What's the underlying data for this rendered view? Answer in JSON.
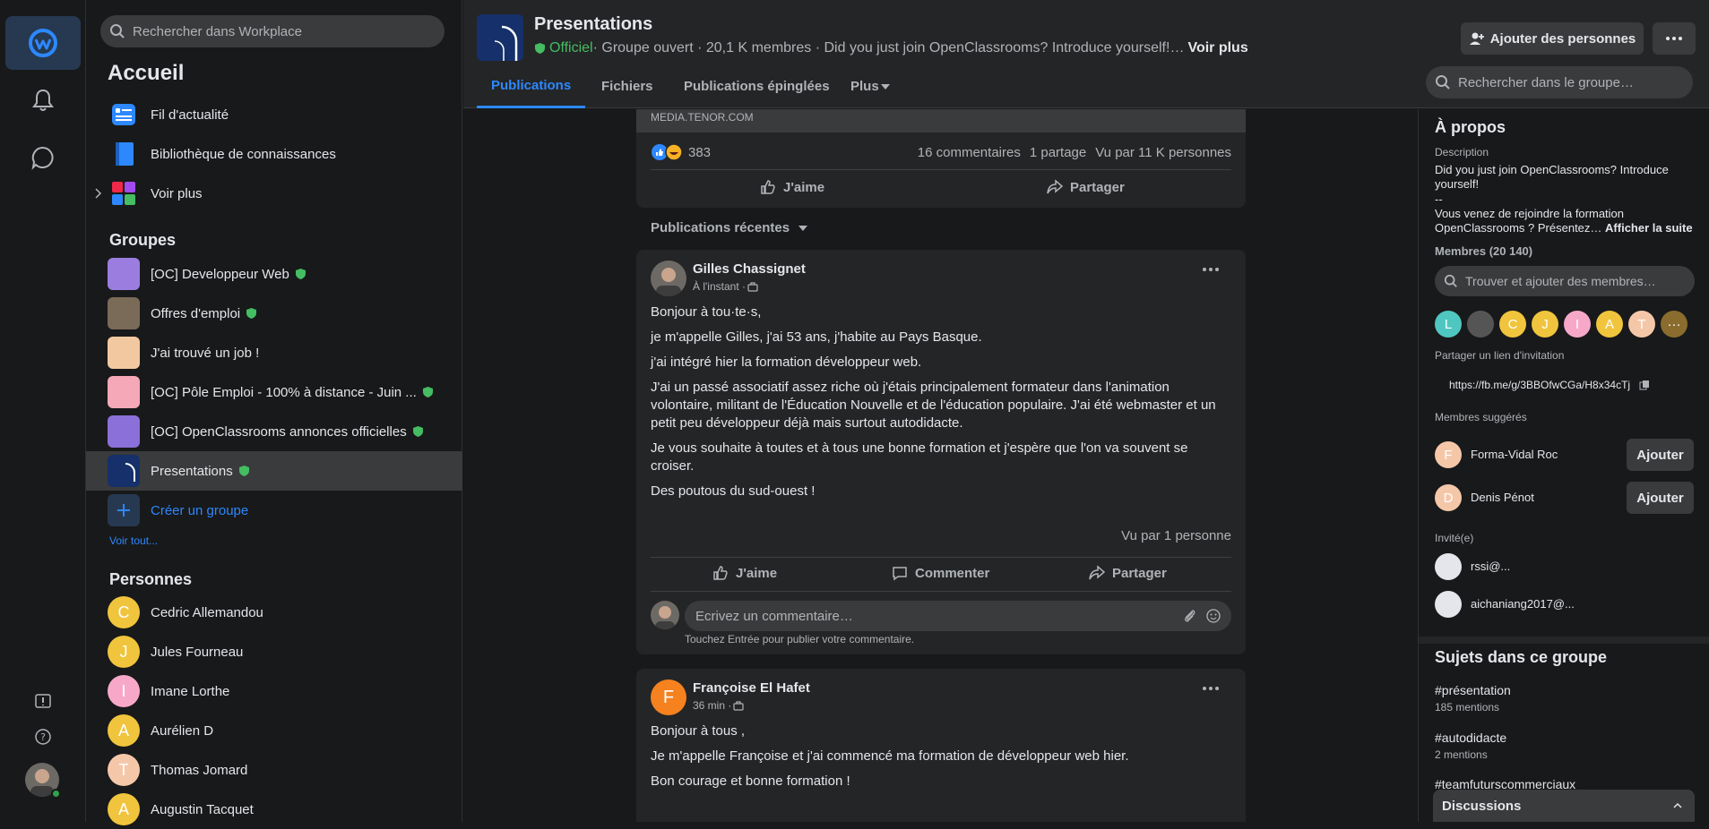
{
  "sidebar": {
    "search_placeholder": "Rechercher dans Workplace",
    "title": "Accueil",
    "nav": [
      {
        "label": "Fil d'actualité"
      },
      {
        "label": "Bibliothèque de connaissances"
      },
      {
        "label": "Voir plus"
      }
    ],
    "groups_heading": "Groupes",
    "groups": [
      {
        "label": "[OC] Developpeur Web"
      },
      {
        "label": "Offres d'emploi"
      },
      {
        "label": "J'ai trouvé un job !"
      },
      {
        "label": "[OC] Pôle Emploi - 100% à distance - Juin ..."
      },
      {
        "label": "[OC] OpenClassrooms annonces officielles"
      },
      {
        "label": "Presentations"
      }
    ],
    "create_group": "Créer un groupe",
    "see_all": "Voir tout...",
    "people_heading": "Personnes",
    "people": [
      {
        "initial": "C",
        "name": "Cedric Allemandou",
        "color": "#f0c43c"
      },
      {
        "initial": "J",
        "name": "Jules Fourneau",
        "color": "#f0c43c"
      },
      {
        "initial": "I",
        "name": "Imane Lorthe",
        "color": "#f7a8c8"
      },
      {
        "initial": "A",
        "name": "Aurélien D",
        "color": "#f0c43c"
      },
      {
        "initial": "T",
        "name": "Thomas Jomard",
        "color": "#f5c7a9"
      },
      {
        "initial": "A",
        "name": "Augustin Tacquet",
        "color": "#f0c43c"
      }
    ]
  },
  "header": {
    "group_name": "Presentations",
    "official": "Officiel",
    "meta": " · Groupe ouvert · 20,1 K membres · Did you just join OpenClassrooms? Introduce yourself!…",
    "see_more": "Voir plus",
    "add_people": "Ajouter des personnes",
    "tabs": [
      "Publications",
      "Fichiers",
      "Publications épinglées",
      "Plus"
    ],
    "search_placeholder": "Rechercher dans le groupe…"
  },
  "feed": {
    "top_card": {
      "link_domain": "MEDIA.TENOR.COM",
      "reactions_count": "383",
      "comments": "16 commentaires",
      "shares": "1 partage",
      "seen": "Vu par 11 K personnes",
      "like": "J'aime",
      "share": "Partager"
    },
    "recent_label": "Publications récentes",
    "post1": {
      "author": "Gilles Chassignet",
      "time": "À l'instant · ",
      "paragraphs": [
        "Bonjour à tou·te·s,",
        "je m'appelle Gilles, j'ai 53 ans, j'habite au Pays Basque.",
        "j'ai intégré hier la formation développeur web.",
        "J'ai un passé associatif assez riche où j'étais principalement formateur dans l'animation volontaire, militant de l'Éducation Nouvelle et de l'éducation populaire. J'ai été webmaster et un petit peu développeur déjà mais surtout autodidacte.",
        "Je vous souhaite à toutes et à tous une bonne formation et j'espère que l'on va souvent se croiser.",
        "Des poutous du sud-ouest !"
      ],
      "seen": "Vu par 1 personne",
      "like": "J'aime",
      "comment": "Commenter",
      "share": "Partager",
      "comment_placeholder": "Ecrivez un commentaire…",
      "comment_hint": "Touchez Entrée pour publier votre commentaire."
    },
    "post2": {
      "author": "Françoise El Hafet",
      "initial": "F",
      "time": "36 min · ",
      "paragraphs": [
        "Bonjour à tous ,",
        "Je m'appelle Françoise et j'ai commencé ma formation de développeur web hier.",
        "Bon courage et bonne formation !"
      ]
    }
  },
  "about": {
    "title": "À propos",
    "desc_label": "Description",
    "desc_line1": "Did you just join OpenClassrooms? Introduce yourself!",
    "desc_line2": "--",
    "desc_line3": "Vous venez de rejoindre la formation OpenClassrooms ? Présentez…",
    "show_more": "Afficher la suite",
    "members_label": "Membres (20 140)",
    "members_search": "Trouver et ajouter des membres…",
    "member_avatars": [
      {
        "initial": "L",
        "color": "#4fc7c0"
      },
      {
        "initial": "",
        "color": "#555"
      },
      {
        "initial": "C",
        "color": "#f0c43c"
      },
      {
        "initial": "J",
        "color": "#f0c43c"
      },
      {
        "initial": "I",
        "color": "#f7a8c8"
      },
      {
        "initial": "A",
        "color": "#f0c43c"
      },
      {
        "initial": "T",
        "color": "#f5c7a9"
      },
      {
        "initial": "···",
        "color": "#8a6d2e"
      }
    ],
    "invite_label": "Partager un lien d'invitation",
    "invite_link": "https://fb.me/g/3BBOfwCGa/H8x34cTj",
    "suggested_label": "Membres suggérés",
    "suggested": [
      {
        "initial": "F",
        "name": "Forma-Vidal Roc",
        "button": "Ajouter"
      },
      {
        "initial": "D",
        "name": "Denis Pénot",
        "button": "Ajouter"
      }
    ],
    "invited_label": "Invité(e)",
    "invited": [
      {
        "name": "rssi@..."
      },
      {
        "name": "aichaniang2017@..."
      }
    ],
    "topics_title": "Sujets dans ce groupe",
    "topics": [
      {
        "tag": "#présentation",
        "count": "185 mentions"
      },
      {
        "tag": "#autodidacte",
        "count": "2 mentions"
      },
      {
        "tag": "#teamfuturscommerciaux",
        "count": ""
      }
    ],
    "discussions": "Discussions"
  },
  "colors": {
    "accent": "#2d88ff",
    "official": "#45bd62",
    "bg": "#18191a",
    "card": "#242526"
  }
}
